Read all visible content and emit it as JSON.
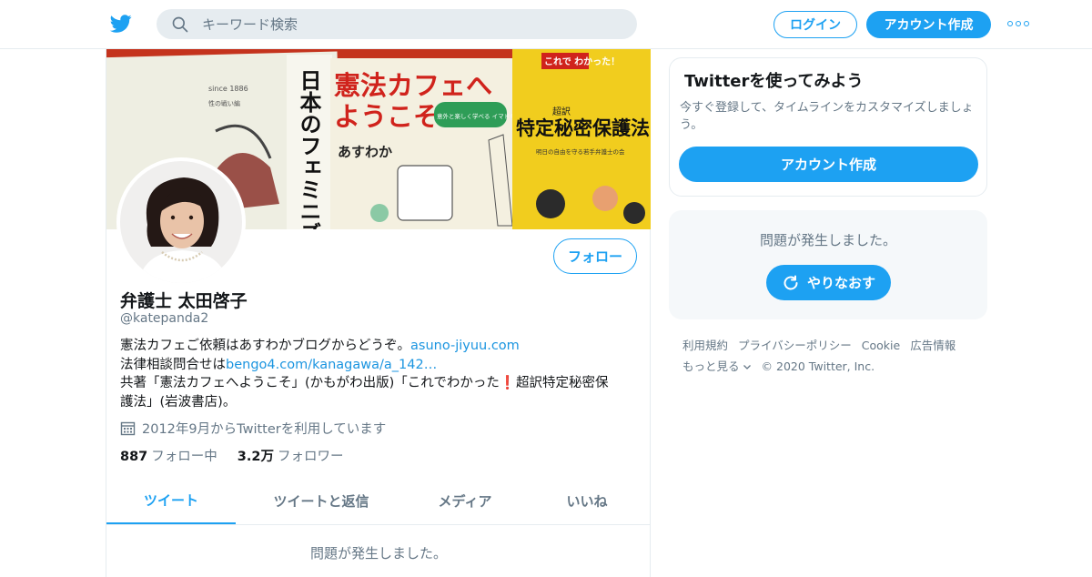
{
  "header": {
    "logo_icon": "twitter-bird-icon",
    "search_placeholder": "キーワード検索",
    "login_label": "ログイン",
    "signup_label": "アカウント作成",
    "more_icon": "more-dots-icon",
    "accent_color": "#1da1f2"
  },
  "profile": {
    "banner_text": {
      "book1_since": "since 1886",
      "book1_sub": "性の戦い編",
      "book1_title": "日本のフェミニズム",
      "book2_title_line1": "憲法カフェへ",
      "book2_title_line2": "ようこそ",
      "book2_tag": "意外と楽しく学べる イマドキの改憲",
      "book2_author": "あすわか",
      "book3_top": "これで わかった！",
      "book3_sub": "超訳",
      "book3_title": "特定秘密保護法",
      "book3_caption": "明日の自由を守る若手弁護士の会"
    },
    "follow_label": "フォロー",
    "name": "弁護士 太田啓子",
    "handle": "@katepanda2",
    "bio": {
      "line1_text": "憲法カフェご依頼はあすわかブログからどうぞ。",
      "line1_link": "asuno-jiyuu.com",
      "line2_text": "法律相談問合せは",
      "line2_link": "bengo4.com/kanagawa/a_142…",
      "line3_text": "共著「憲法カフェへようこそ」(かもがわ出版)「これでわかった",
      "line3_emoji": "❗",
      "line3_rest": "超訳特定秘密保",
      "line4_text": "護法」(岩波書店)。"
    },
    "joined_icon": "calendar-icon",
    "joined": "2012年9月からTwitterを利用しています",
    "following_count": "887",
    "following_label": "フォロー中",
    "followers_count": "3.2万",
    "followers_label": "フォロワー",
    "tabs": [
      {
        "label": "ツイート",
        "active": true
      },
      {
        "label": "ツイートと返信",
        "active": false
      },
      {
        "label": "メディア",
        "active": false
      },
      {
        "label": "いいね",
        "active": false
      }
    ],
    "error_message": "問題が発生しました。"
  },
  "sidebar": {
    "try_title": "Twitterを使ってみよう",
    "try_desc": "今すぐ登録して、タイムラインをカスタマイズしましょう。",
    "try_button": "アカウント作成",
    "error_message": "問題が発生しました。",
    "retry_icon": "refresh-icon",
    "retry_label": "やりなおす"
  },
  "footer": {
    "links": [
      "利用規約",
      "プライバシーポリシー",
      "Cookie",
      "広告情報"
    ],
    "more_label": "もっと見る",
    "copyright": "© 2020 Twitter, Inc."
  }
}
